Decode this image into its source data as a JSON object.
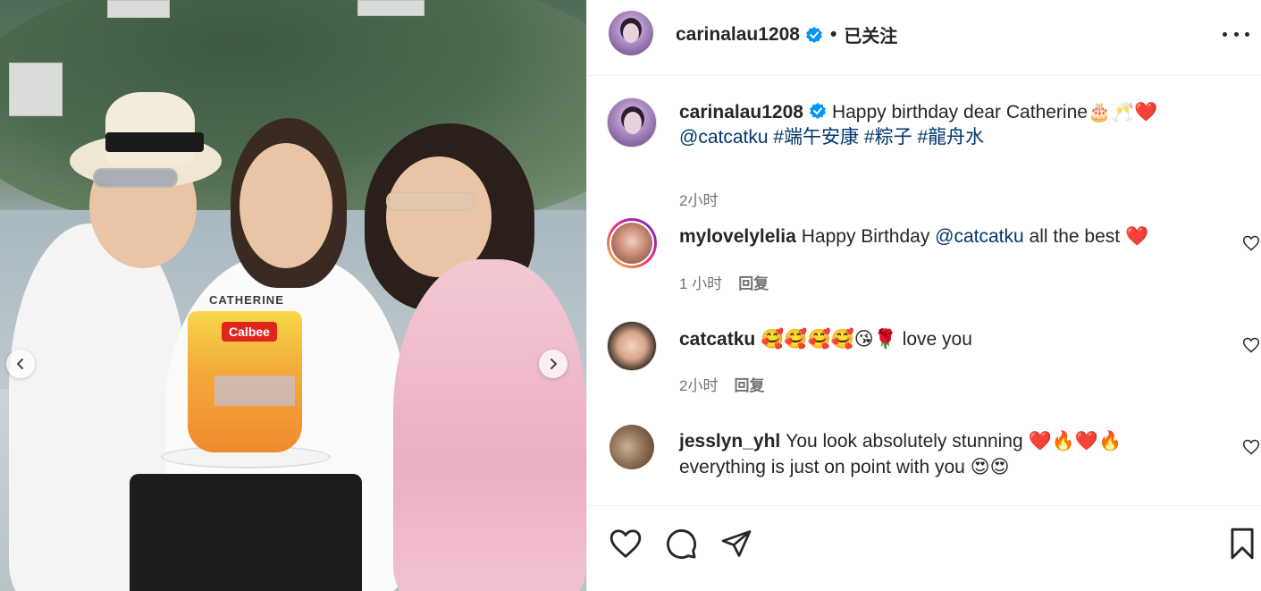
{
  "post": {
    "author": "carinalau1208",
    "separator": "•",
    "follow_status": "已关注",
    "carousel": {
      "prev_icon": "chevron-left-icon",
      "next_icon": "chevron-right-icon"
    },
    "photo_text": {
      "cake_brand": "Calbee",
      "cake_topper": "CATHERINE"
    }
  },
  "caption": {
    "username": "carinalau1208",
    "text": "Happy birthday dear Catherine",
    "emojis": "🎂🥂❤️",
    "mention": "@catcatku",
    "hashtags": [
      "#端午安康",
      "#粽子",
      "#龍舟水"
    ],
    "time": "2小时"
  },
  "comments": [
    {
      "username": "mylovelylelia",
      "text_before": "Happy Birthday",
      "mention": "@catcatku",
      "text_after": "all the best",
      "emojis": "❤️",
      "time": "1 小时",
      "reply_label": "回复"
    },
    {
      "username": "catcatku",
      "emojis": "🥰🥰🥰🥰😘🌹",
      "text_after": "love you",
      "time": "2小时",
      "reply_label": "回复"
    },
    {
      "username": "jesslyn_yhl",
      "text_line1": "You look absolutely stunning",
      "emojis_line1": "❤️🔥❤️🔥",
      "text_line2": "everything is just on point with you",
      "emojis_line2": "😍😍"
    }
  ],
  "actions": {
    "like_icon": "heart-icon",
    "comment_icon": "comment-icon",
    "share_icon": "send-icon",
    "save_icon": "bookmark-icon"
  },
  "colors": {
    "link": "#00376b",
    "verified": "#0095f6",
    "heart_red": "#ed1c24",
    "muted": "#737373"
  }
}
